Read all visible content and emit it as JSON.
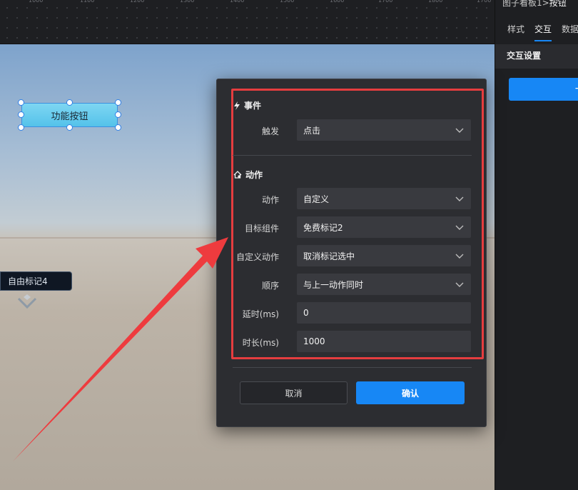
{
  "ruler": {
    "ticks": [
      "1000",
      "1100",
      "1200",
      "1300",
      "1400",
      "1500",
      "1600",
      "1700",
      "1800",
      "1700"
    ]
  },
  "canvas": {
    "function_button_label": "功能按钮",
    "marker_label": "自由标记4"
  },
  "modal": {
    "event_section": {
      "title": "事件",
      "icon": "lightning-icon",
      "trigger": {
        "label": "触发",
        "value": "点击"
      }
    },
    "action_section": {
      "title": "动作",
      "icon": "home-gear-icon",
      "rows": [
        {
          "label": "动作",
          "value": "自定义"
        },
        {
          "label": "目标组件",
          "value": "免费标记2"
        },
        {
          "label": "自定义动作",
          "value": "取消标记选中"
        },
        {
          "label": "顺序",
          "value": "与上一动作同时"
        }
      ],
      "delay": {
        "label": "延时(ms)",
        "value": "0"
      },
      "duration": {
        "label": "时长(ms)",
        "value": "1000"
      }
    },
    "cancel_label": "取消",
    "confirm_label": "确认"
  },
  "right_panel": {
    "breadcrumb_prefix": "图子看板1",
    "breadcrumb_sep": ">",
    "breadcrumb_current": "按钮",
    "tabs": [
      "样式",
      "交互",
      "数据"
    ],
    "active_tab": "交互",
    "section_title": "交互设置",
    "add_button_label": "+"
  },
  "colors": {
    "accent": "#1787f5",
    "highlight": "#e53d3f",
    "modal_bg": "#2c2d31"
  }
}
